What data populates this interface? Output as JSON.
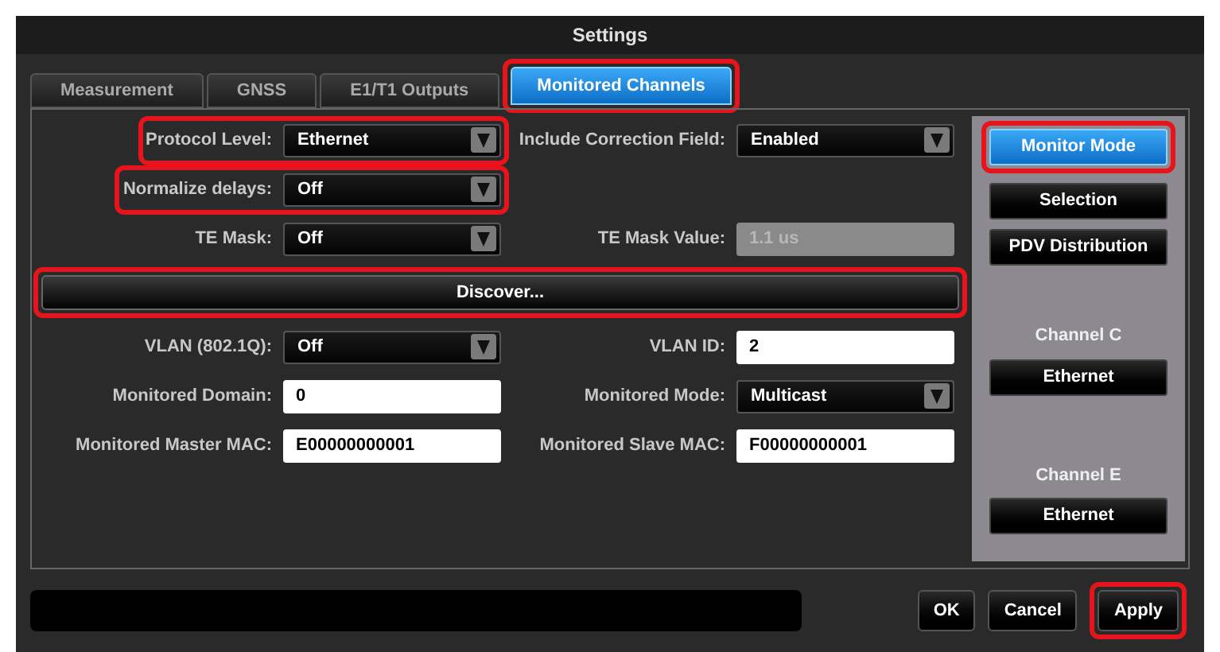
{
  "window": {
    "title": "Settings"
  },
  "tabs": [
    {
      "label": "Measurement",
      "selected": false,
      "highlighted": false
    },
    {
      "label": "GNSS",
      "selected": false,
      "highlighted": false
    },
    {
      "label": "E1/T1 Outputs",
      "selected": false,
      "highlighted": false
    },
    {
      "label": "Monitored Channels",
      "selected": true,
      "highlighted": true
    }
  ],
  "rows": [
    {
      "kind": "fields",
      "cells": [
        {
          "label": "Protocol Level:",
          "kind": "select",
          "value": "Ethernet",
          "highlighted": true
        },
        {
          "label": "Include Correction Field:",
          "kind": "select",
          "value": "Enabled",
          "highlighted": false
        }
      ]
    },
    {
      "kind": "fields",
      "cells": [
        {
          "label": "Normalize delays:",
          "kind": "select",
          "value": "Off",
          "highlighted": true
        }
      ]
    },
    {
      "kind": "fields",
      "cells": [
        {
          "label": "TE Mask:",
          "kind": "select",
          "value": "Off",
          "highlighted": false
        },
        {
          "label": "TE Mask Value:",
          "kind": "input",
          "value": "1.1 us",
          "disabled": true,
          "highlighted": false
        }
      ]
    },
    {
      "kind": "button",
      "label": "Discover...",
      "highlighted": true
    },
    {
      "kind": "fields",
      "cells": [
        {
          "label": "VLAN (802.1Q):",
          "kind": "select",
          "value": "Off",
          "highlighted": false
        },
        {
          "label": "VLAN ID:",
          "kind": "input",
          "value": "2",
          "disabled": false,
          "highlighted": false
        }
      ]
    },
    {
      "kind": "fields",
      "cells": [
        {
          "label": "Monitored Domain:",
          "kind": "input",
          "value": "0",
          "disabled": false,
          "highlighted": false
        },
        {
          "label": "Monitored Mode:",
          "kind": "select",
          "value": "Multicast",
          "highlighted": false
        }
      ]
    },
    {
      "kind": "fields",
      "cells": [
        {
          "label": "Monitored Master MAC:",
          "kind": "input",
          "value": "E00000000001",
          "disabled": false,
          "highlighted": false
        },
        {
          "label": "Monitored Slave MAC:",
          "kind": "input",
          "value": "F00000000001",
          "disabled": false,
          "highlighted": false
        }
      ]
    }
  ],
  "side_panel": [
    {
      "kind": "button",
      "label": "Monitor Mode",
      "selected": true,
      "highlighted": true
    },
    {
      "kind": "button",
      "label": "Selection",
      "selected": false,
      "highlighted": false
    },
    {
      "kind": "button",
      "label": "PDV Distribution",
      "selected": false,
      "highlighted": false
    },
    {
      "kind": "channel",
      "label": "Channel C",
      "value": "Ethernet"
    },
    {
      "kind": "channel",
      "label": "Channel E",
      "value": "Ethernet"
    }
  ],
  "buttons": [
    {
      "label": "OK",
      "highlighted": false
    },
    {
      "label": "Cancel",
      "highlighted": false
    },
    {
      "label": "Apply",
      "highlighted": true
    }
  ]
}
